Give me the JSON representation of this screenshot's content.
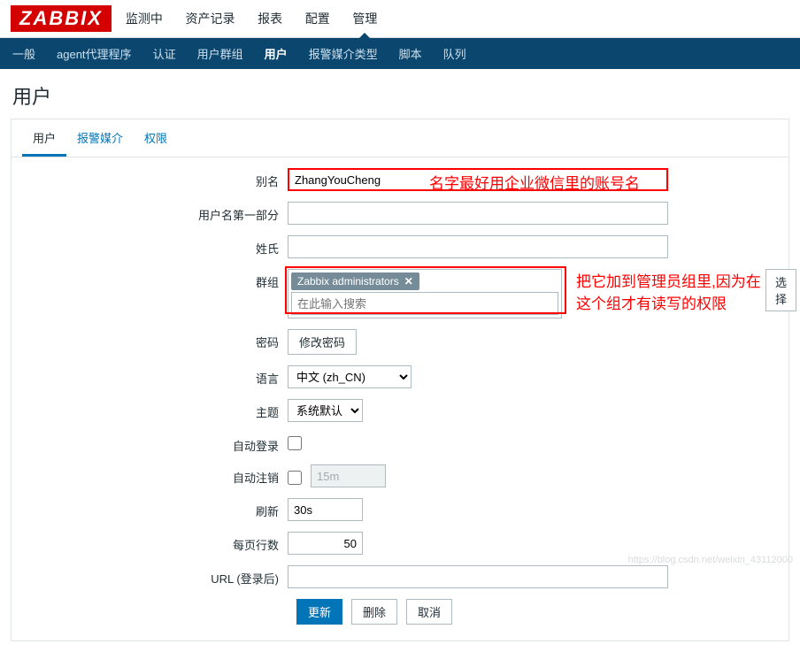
{
  "brand": "ZABBIX",
  "topnav": {
    "items": [
      "监测中",
      "资产记录",
      "报表",
      "配置",
      "管理"
    ],
    "activeIndex": 4
  },
  "subnav": {
    "items": [
      "一般",
      "agent代理程序",
      "认证",
      "用户群组",
      "用户",
      "报警媒介类型",
      "脚本",
      "队列"
    ],
    "activeIndex": 4
  },
  "page_title": "用户",
  "tabs": {
    "items": [
      "用户",
      "报警媒介",
      "权限"
    ],
    "activeIndex": 0
  },
  "form": {
    "alias_label": "别名",
    "alias_value": "ZhangYouCheng",
    "alias_annotation": "名字最好用企业微信里的账号名",
    "name_label": "用户名第一部分",
    "name_value": "",
    "surname_label": "姓氏",
    "surname_value": "",
    "group_label": "群组",
    "group_tag": "Zabbix administrators",
    "group_search_placeholder": "在此输入搜索",
    "group_select_btn": "选择",
    "group_annotation_line1": "把它加到管理员组里,因为在",
    "group_annotation_line2": "这个组才有读写的权限",
    "password_label": "密码",
    "password_btn": "修改密码",
    "lang_label": "语言",
    "lang_value": "中文 (zh_CN)",
    "theme_label": "主题",
    "theme_value": "系统默认",
    "autologin_label": "自动登录",
    "autologout_label": "自动注销",
    "autologout_value": "15m",
    "refresh_label": "刷新",
    "refresh_value": "30s",
    "rows_label": "每页行数",
    "rows_value": "50",
    "url_label": "URL (登录后)",
    "url_value": ""
  },
  "actions": {
    "update": "更新",
    "delete": "删除",
    "cancel": "取消"
  },
  "watermark": "https://blog.csdn.net/weixin_43112000"
}
